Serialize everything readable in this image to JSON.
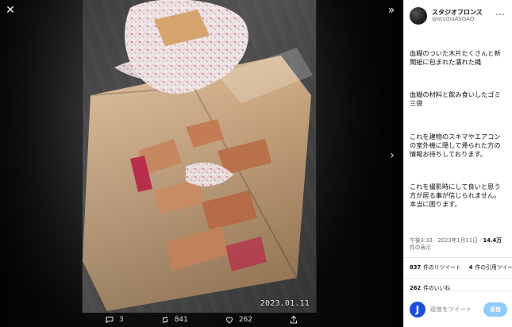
{
  "viewer": {
    "date_overlay": "2023.01.11",
    "actions": {
      "reply_count": "3",
      "retweet_count": "841",
      "like_count": "262"
    }
  },
  "tweet": {
    "author": {
      "display_name": "スタジオブロンズ",
      "handle": "@studioASGAO"
    },
    "paragraphs": [
      "血糊のついた木片たくさんと新聞紙に包まれた濡れた縄",
      "血糊の材料と飲み食いしたゴミ\n三袋",
      "これを建物のスキマやエアコンの室外機に隠して帰られた方の情報お待ちしております。",
      "これを撮影時にして良いと思う方が居る事が信じられません。\n本当に困ります。"
    ],
    "meta": {
      "time_line": "午後3:33 · 2023年1月11日 · ",
      "views_value": "14.4万",
      "views_suffix": " 件の表示"
    },
    "stats": {
      "retweets_value": "837",
      "retweets_label": "件のリツイート",
      "quotes_value": "4",
      "quotes_label": "件の引用ツイート",
      "likes_value": "262",
      "likes_label": "件のいいね"
    },
    "reply_box": {
      "avatar_letter": "J",
      "placeholder": "返信をツイート",
      "button_label": "返信"
    }
  }
}
